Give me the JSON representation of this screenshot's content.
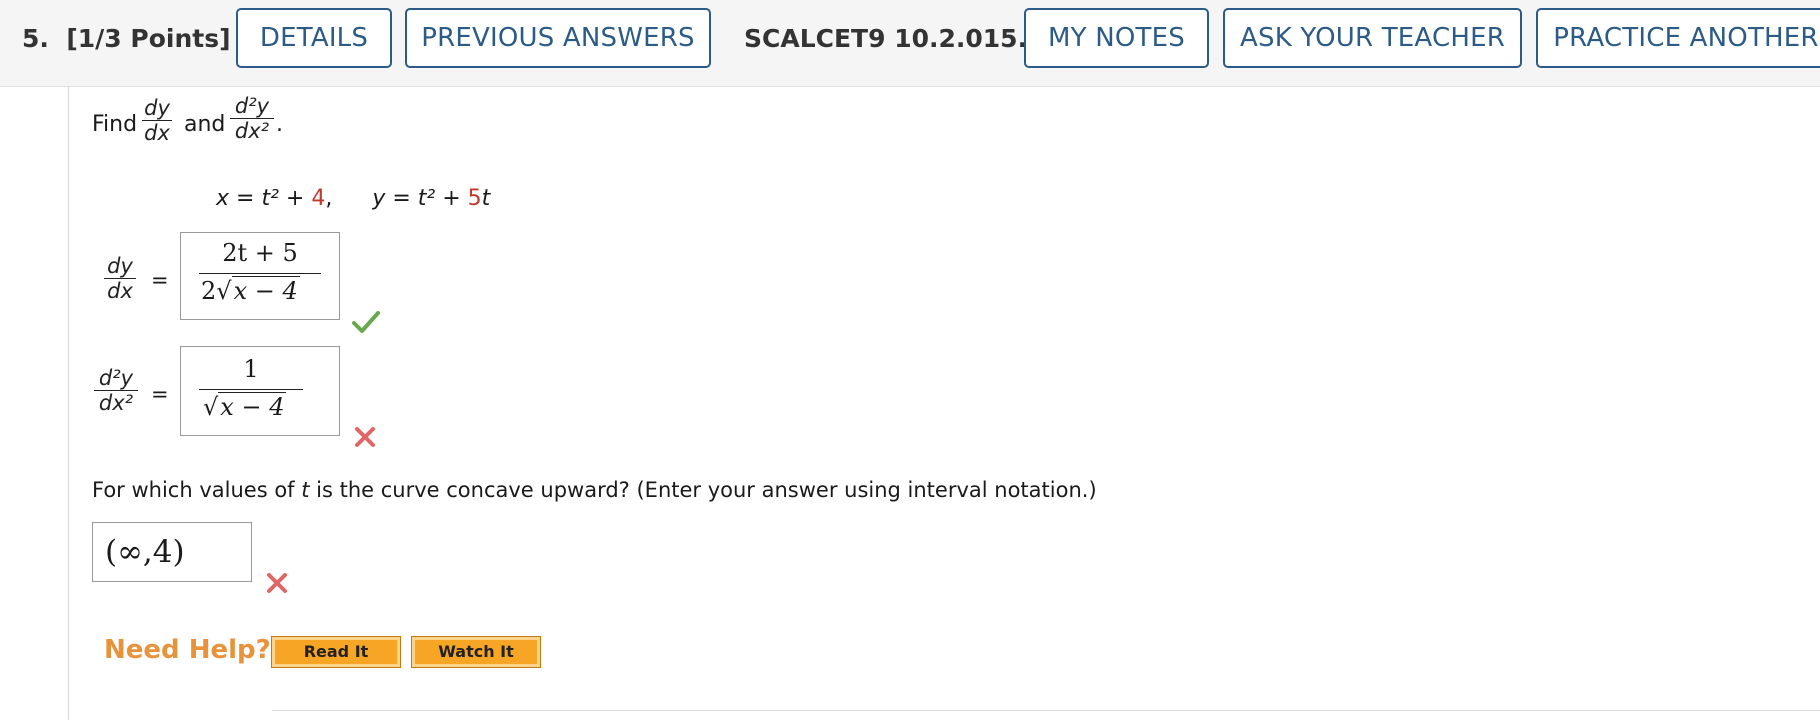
{
  "header": {
    "question_number": "5.",
    "points": "[1/3 Points]",
    "details_label": "DETAILS",
    "previous_answers_label": "PREVIOUS ANSWERS",
    "question_id": "SCALCET9 10.2.015.",
    "my_notes_label": "MY NOTES",
    "ask_teacher_label": "ASK YOUR TEACHER",
    "practice_another_label": "PRACTICE ANOTHER"
  },
  "prompt": {
    "find_word": "Find",
    "and_word": "and",
    "period": ".",
    "dy": "dy",
    "dx": "dx",
    "d2y": "d²y",
    "dx2": "dx²"
  },
  "equation": {
    "x_lhs": "x = t² + ",
    "x_const": "4",
    "x_sep": ",",
    "y_lhs": "y = t² + ",
    "y_coef": "5",
    "y_var": "t"
  },
  "answers": {
    "first_derivative": {
      "equals": "=",
      "numerator": "2t + 5",
      "den_coef": "2",
      "radicand": "x − 4",
      "status": "correct",
      "status_color": "#6aa84f"
    },
    "second_derivative": {
      "equals": "=",
      "numerator": "1",
      "radicand": "x − 4",
      "status": "incorrect",
      "status_color": "#e06666"
    }
  },
  "question": {
    "text_before": "For which values of ",
    "variable": "t",
    "text_after": " is the curve concave upward? (Enter your answer using interval notation.)",
    "answer_value": "(∞,4)",
    "status": "incorrect"
  },
  "help": {
    "label": "Need Help?",
    "read_it": "Read It",
    "watch_it": "Watch It"
  },
  "colors": {
    "accent": "#2b5b86",
    "highlight_number": "#c0392b",
    "need_help": "#e8923b",
    "help_button": "#f6a524"
  }
}
